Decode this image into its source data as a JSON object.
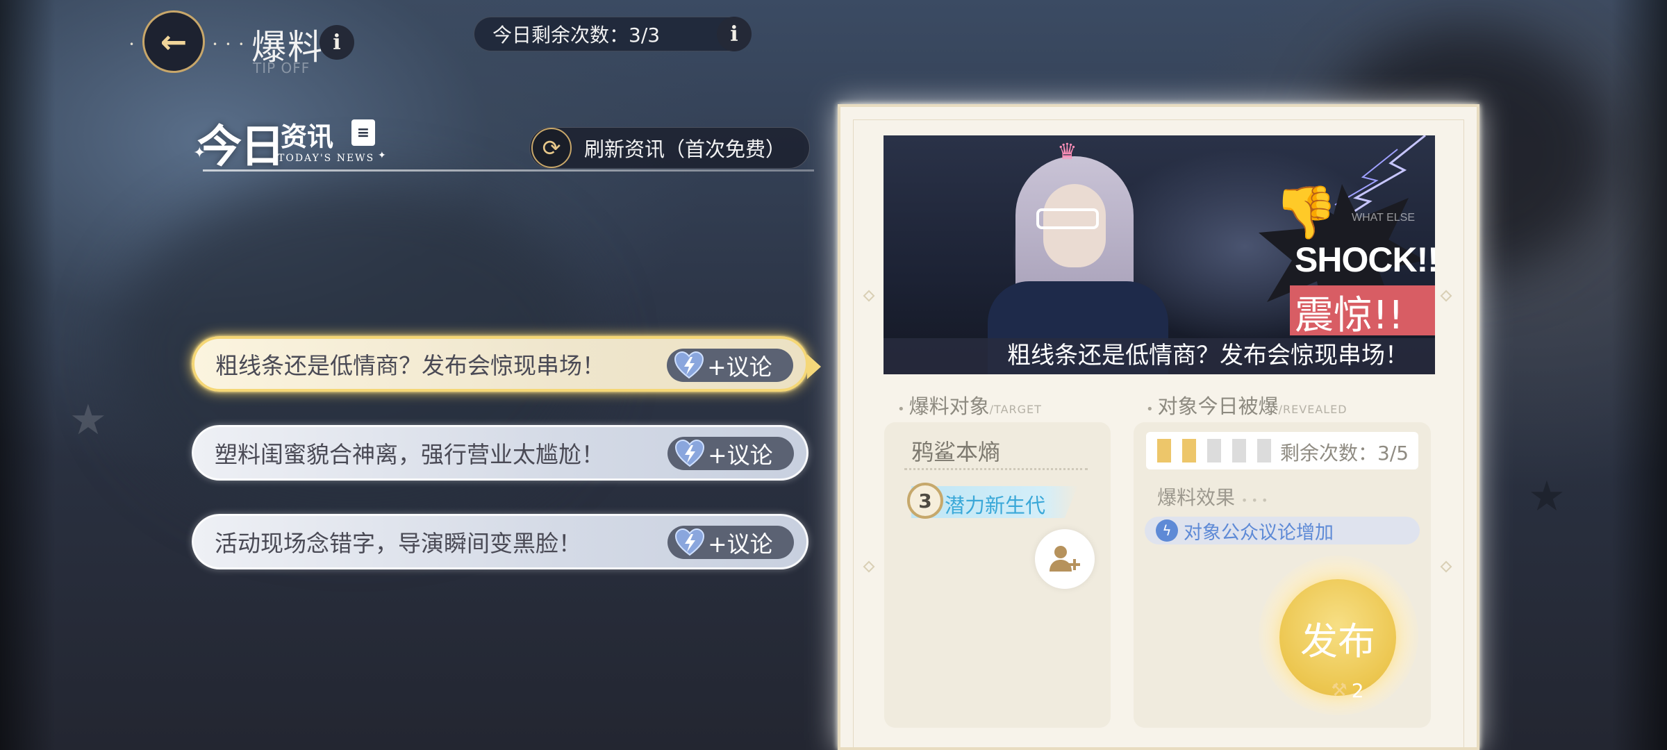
{
  "header": {
    "title": "爆料",
    "subtitle": "TIP OFF",
    "remaining_today": "今日剩余次数：3/3"
  },
  "icons": {
    "back": "back-arrow-icon",
    "info": "info-icon",
    "refresh": "refresh-icon",
    "heart": "heart-lightning-icon",
    "add_person": "add-person-icon",
    "publish_cost": "hammer-icon"
  },
  "news": {
    "logo_main": "今日",
    "logo_secondary": "资讯",
    "logo_en": "TODAY'S NEWS",
    "refresh_label": "刷新资讯（首次免费）",
    "items": [
      {
        "text": "粗线条还是低情商？发布会惊现串场！",
        "tag": "+议论",
        "selected": true
      },
      {
        "text": "塑料闺蜜貌合神离，强行营业太尴尬！",
        "tag": "+议论",
        "selected": false
      },
      {
        "text": "活动现场念错字，导演瞬间变黑脸！",
        "tag": "+议论",
        "selected": false
      }
    ]
  },
  "detail": {
    "image": {
      "shock_en": "SHOCK!!",
      "shock_cn": "震惊!!",
      "watermark": "WHAT ELSE",
      "caption": "粗线条还是低情商？发布会惊现串场！"
    },
    "target_section": {
      "title": "爆料对象",
      "title_en": "/TARGET"
    },
    "target": {
      "name": "鸦鲨本熵",
      "level": "3",
      "tag": "潜力新生代"
    },
    "revealed_section": {
      "title": "对象今日被爆",
      "title_en": "/REVEALED"
    },
    "revealed": {
      "filled": 2,
      "total": 5,
      "counter_text": "剩余次数：3/5",
      "effect_title": "爆料效果",
      "effect": "对象公众议论增加"
    },
    "publish": {
      "label": "发布",
      "cost": "2"
    }
  },
  "colors": {
    "accent_gold": "#f5d776",
    "tag_bg": "#5b6273",
    "publish_gold": "#ecc64f",
    "shock_red": "#d85d64",
    "effect_blue": "#5e8ad6"
  }
}
